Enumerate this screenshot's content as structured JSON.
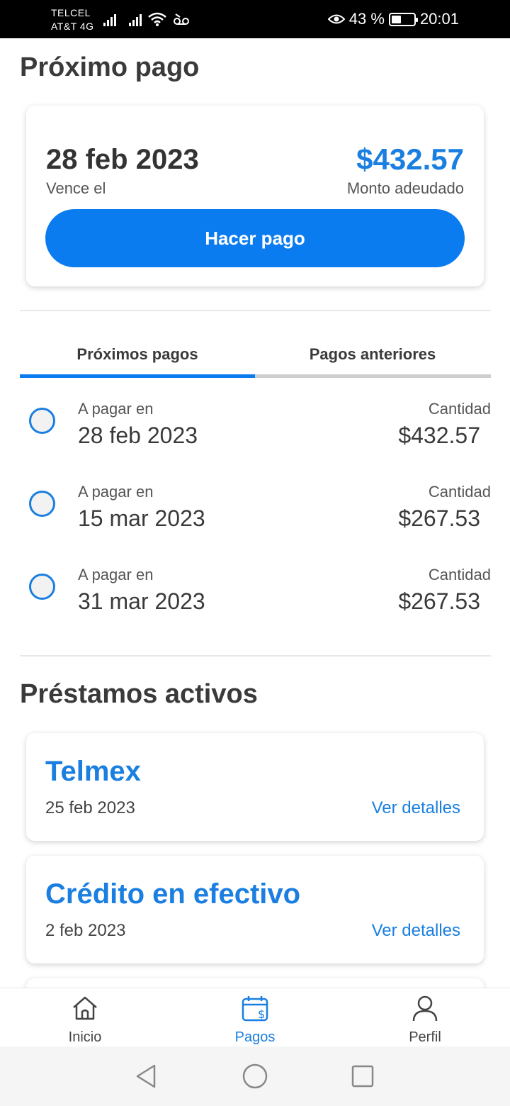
{
  "status_bar": {
    "carrier_line1": "TELCEL",
    "carrier_line2": "AT&T 4G",
    "battery": "43 %",
    "battery_level": 0.43,
    "time": "20:01"
  },
  "next_payment": {
    "heading": "Próximo pago",
    "due_date": "28 feb 2023",
    "due_label": "Vence el",
    "amount": "$432.57",
    "amount_label": "Monto adeudado",
    "pay_button": "Hacer pago"
  },
  "tabs": [
    {
      "label": "Próximos pagos",
      "active": true
    },
    {
      "label": "Pagos anteriores",
      "active": false
    }
  ],
  "payments": [
    {
      "label": "A pagar en",
      "date": "28 feb 2023",
      "qty_label": "Cantidad",
      "amount": "$432.57"
    },
    {
      "label": "A pagar en",
      "date": "15 mar 2023",
      "qty_label": "Cantidad",
      "amount": "$267.53"
    },
    {
      "label": "A pagar en",
      "date": "31 mar 2023",
      "qty_label": "Cantidad",
      "amount": "$267.53"
    }
  ],
  "loans": {
    "heading": "Préstamos activos",
    "items": [
      {
        "title": "Telmex",
        "date": "25 feb 2023",
        "link": "Ver detalles"
      },
      {
        "title": "Crédito en efectivo",
        "date": "2 feb 2023",
        "link": "Ver detalles"
      }
    ]
  },
  "bottom_nav": [
    {
      "label": "Inicio",
      "icon": "home-icon",
      "active": false
    },
    {
      "label": "Pagos",
      "icon": "calendar-dollar-icon",
      "active": true
    },
    {
      "label": "Perfil",
      "icon": "person-icon",
      "active": false
    }
  ],
  "colors": {
    "accent": "#0a7cf0",
    "link": "#1a7fe0",
    "text": "#3a3a3a"
  }
}
